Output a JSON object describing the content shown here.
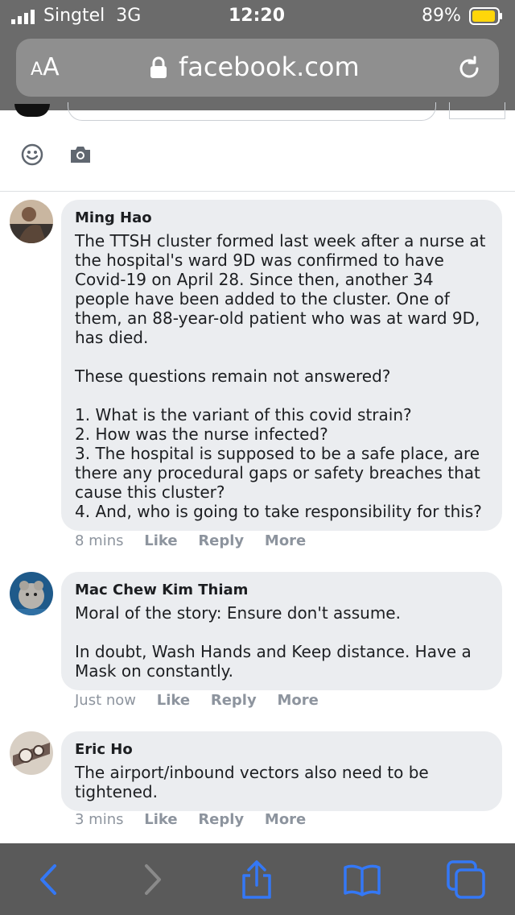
{
  "status_bar": {
    "carrier": "Singtel",
    "network": "3G",
    "time": "12:20",
    "battery": "89%"
  },
  "browser": {
    "text_size_label": "AA",
    "url": "facebook.com"
  },
  "comments": [
    {
      "author": "Ming Hao",
      "text": "The TTSH cluster formed last week after a nurse at the hospital's ward 9D was confirmed to have Covid-19 on April 28. Since then, another 34 people have been added to the cluster. One of them, an 88-year-old patient who was at ward 9D, has died.\n\nThese questions remain not answered?\n\n1. What is the variant of this covid strain?\n2. How was the nurse infected?\n3. The hospital is supposed to be a safe place, are there any procedural gaps or safety breaches that cause this cluster?\n4. And, who is going to take responsibility for this?",
      "time": "8 mins",
      "like": "Like",
      "reply": "Reply",
      "more": "More"
    },
    {
      "author": "Mac Chew Kim Thiam",
      "text": "Moral of the story: Ensure don't assume.\n\nIn doubt, Wash Hands and Keep distance. Have a Mask on constantly.",
      "time": "Just now",
      "like": "Like",
      "reply": "Reply",
      "more": "More"
    },
    {
      "author": "Eric Ho",
      "text": "The airport/inbound vectors also need to be tightened.",
      "time": "3 mins",
      "like": "Like",
      "reply": "Reply",
      "more": "More"
    }
  ],
  "colors": {
    "accent": "#3478f6",
    "bubble": "#ebedf0",
    "meta": "#8d949e"
  }
}
